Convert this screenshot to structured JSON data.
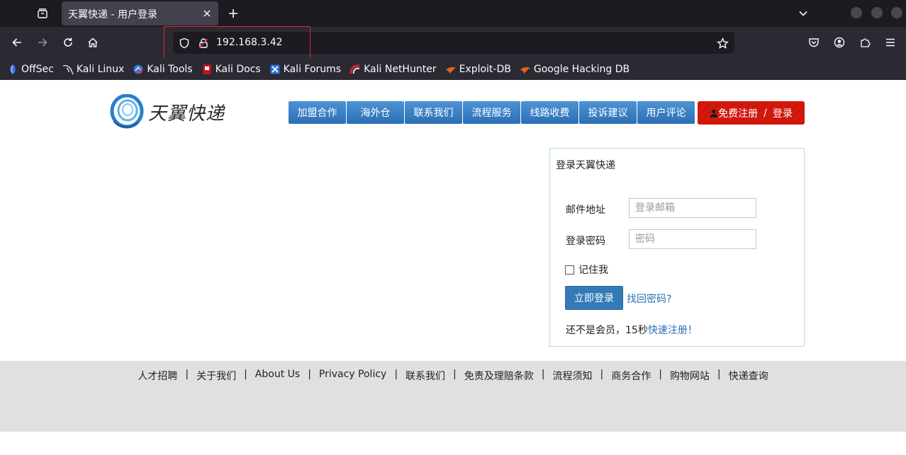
{
  "browser": {
    "tab_title": "天翼快递 - 用户登录",
    "url": "192.168.3.42",
    "bookmarks": [
      {
        "label": "OffSec",
        "icon": "offsec-icon"
      },
      {
        "label": "Kali Linux",
        "icon": "kali-dragon-icon"
      },
      {
        "label": "Kali Tools",
        "icon": "kali-tools-icon"
      },
      {
        "label": "Kali Docs",
        "icon": "kali-docs-icon"
      },
      {
        "label": "Kali Forums",
        "icon": "kali-forums-icon"
      },
      {
        "label": "Kali NetHunter",
        "icon": "nethunter-icon"
      },
      {
        "label": "Exploit-DB",
        "icon": "exploit-db-icon"
      },
      {
        "label": "Google Hacking DB",
        "icon": "ghdb-icon"
      }
    ]
  },
  "site": {
    "logo_text": "天翼快递",
    "menu": [
      "加盟合作",
      "海外仓",
      "联系我们",
      "流程服务",
      "线路收费",
      "投诉建议",
      "用户评论"
    ],
    "register": {
      "register_label": "免费注册",
      "separator": "/",
      "login_label": "登录"
    }
  },
  "login": {
    "title": "登录天翼快递",
    "email_label": "邮件地址",
    "email_placeholder": "登录邮箱",
    "password_label": "登录密码",
    "password_placeholder": "密码",
    "remember_label": "记住我",
    "submit_label": "立即登录",
    "forgot_label": "找回密码?",
    "not_member_text": "还不是会员，15秒",
    "quick_register_label": "快速注册！"
  },
  "footer": {
    "links": [
      "人才招聘",
      "关于我们",
      "About Us",
      "Privacy Policy",
      "联系我们",
      "免责及理赔条款",
      "流程须知",
      "商务合作",
      "购物网站",
      "快递查询"
    ]
  },
  "colors": {
    "menu_blue": "#3a80c6",
    "register_red": "#d4180e",
    "link_blue": "#2a6fb3",
    "url_highlight": "#e02b2b"
  }
}
